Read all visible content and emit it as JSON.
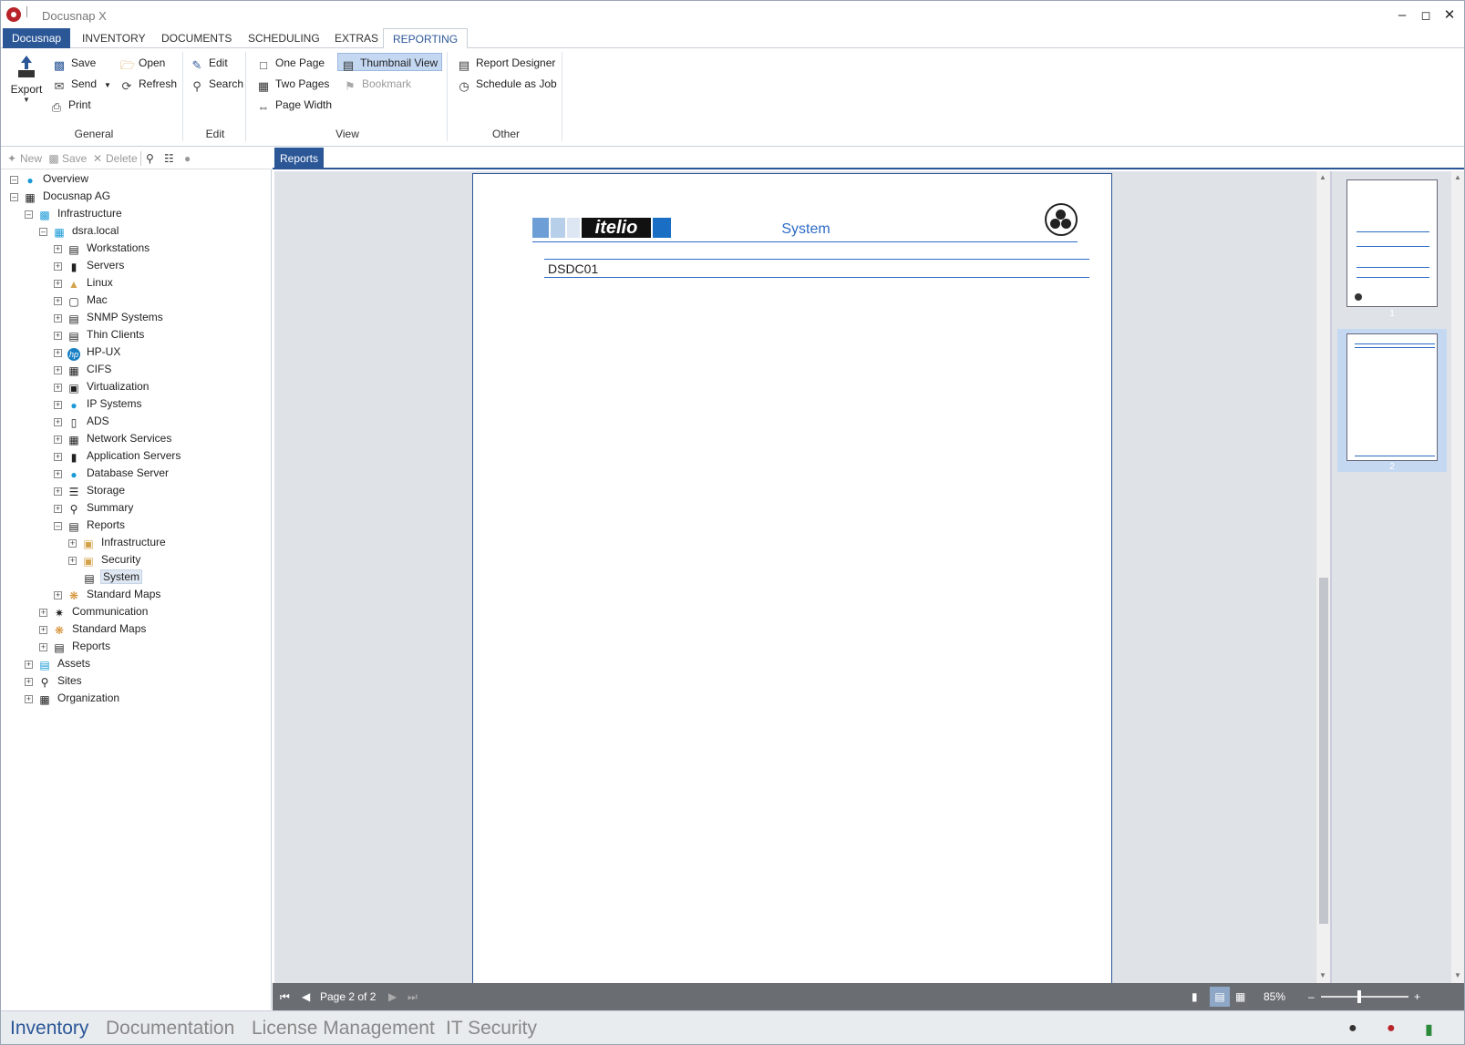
{
  "window": {
    "title": "Docusnap X"
  },
  "menu": {
    "tabs": [
      {
        "label": "Docusnap"
      },
      {
        "label": "INVENTORY"
      },
      {
        "label": "DOCUMENTS"
      },
      {
        "label": "SCHEDULING"
      },
      {
        "label": "EXTRAS"
      },
      {
        "label": "REPORTING"
      }
    ]
  },
  "ribbon": {
    "general": {
      "label": "General",
      "export": "Export",
      "save": "Save",
      "send": "Send",
      "print": "Print",
      "open": "Open",
      "refresh": "Refresh"
    },
    "edit": {
      "label": "Edit",
      "edit": "Edit",
      "search": "Search"
    },
    "view": {
      "label": "View",
      "one_page": "One Page",
      "two_pages": "Two Pages",
      "page_width": "Page Width",
      "thumbnail_view": "Thumbnail View",
      "bookmark": "Bookmark"
    },
    "other": {
      "label": "Other",
      "report_designer": "Report Designer",
      "schedule_as_job": "Schedule as Job"
    }
  },
  "left_toolbar": {
    "new": "New",
    "save": "Save",
    "delete": "Delete"
  },
  "tree": {
    "overview": "Overview",
    "company": "Docusnap AG",
    "infrastructure": "Infrastructure",
    "domain": "dsra.local",
    "domain_children": [
      "Workstations",
      "Servers",
      "Linux",
      "Mac",
      "SNMP Systems",
      "Thin Clients",
      "HP-UX",
      "CIFS",
      "Virtualization",
      "IP Systems",
      "ADS",
      "Network Services",
      "Application Servers",
      "Database Server",
      "Storage",
      "Summary",
      "Reports"
    ],
    "reports_children": [
      "Infrastructure",
      "Security",
      "System"
    ],
    "standard_maps_inner": "Standard Maps",
    "communication": "Communication",
    "standard_maps": "Standard Maps",
    "reports": "Reports",
    "assets": "Assets",
    "sites": "Sites",
    "organization": "Organization"
  },
  "doc_tab": "Reports",
  "report": {
    "logo_text": "itelio",
    "title": "System",
    "system_name": "DSDC01"
  },
  "thumbnails": [
    {
      "label": "1"
    },
    {
      "label": "2"
    }
  ],
  "page_nav": {
    "status": "Page 2 of 2",
    "zoom": "85%"
  },
  "bottom_nav": [
    "Inventory",
    "Documentation",
    "License Management",
    "IT Security"
  ],
  "colors": {
    "accent": "#2b5797",
    "selection": "#c4d8f2"
  }
}
